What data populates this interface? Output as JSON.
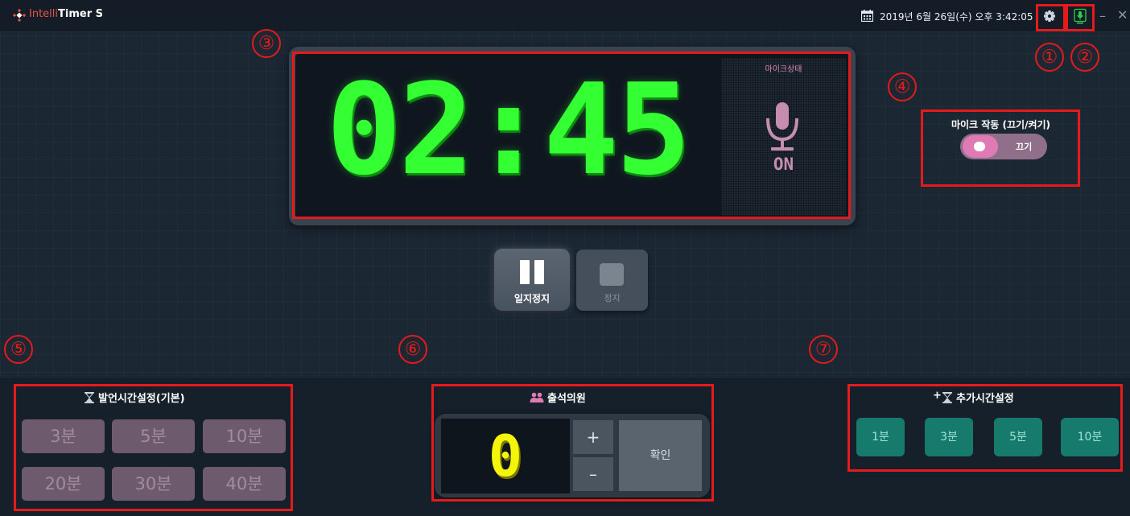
{
  "titlebar": {
    "brand": "Intelli",
    "title_rest": "Timer S",
    "datetime": "2019년 6월 26일(수) 오후 3:42:05",
    "minimize": "–",
    "close": "✕"
  },
  "callouts": [
    "①",
    "②",
    "③",
    "④",
    "⑤",
    "⑥",
    "⑦"
  ],
  "timer": {
    "display": "02:45",
    "digit_color": "#33ff33"
  },
  "mic_status": {
    "title": "마이크상태",
    "state": "ON",
    "color": "#c58db0"
  },
  "controls": {
    "pause_label": "일지정지",
    "stop_label": "정지"
  },
  "mic_toggle": {
    "title": "마이크 작동 (끄기/켜기)",
    "label": "끄기",
    "color": "#e07ab4"
  },
  "speech_time": {
    "title": "발언시간설정(기본)",
    "buttons": [
      "3분",
      "5분",
      "10분",
      "20분",
      "30분",
      "40분"
    ]
  },
  "attendance": {
    "title": "출석의원",
    "count": "0",
    "plus": "+",
    "minus": "–",
    "confirm": "확인"
  },
  "extra_time": {
    "title": "추가시간설정",
    "prefix": "+",
    "buttons": [
      "1분",
      "3분",
      "5분",
      "10분"
    ],
    "color": "#167a6c"
  },
  "annotation_color": "#e51a1a"
}
